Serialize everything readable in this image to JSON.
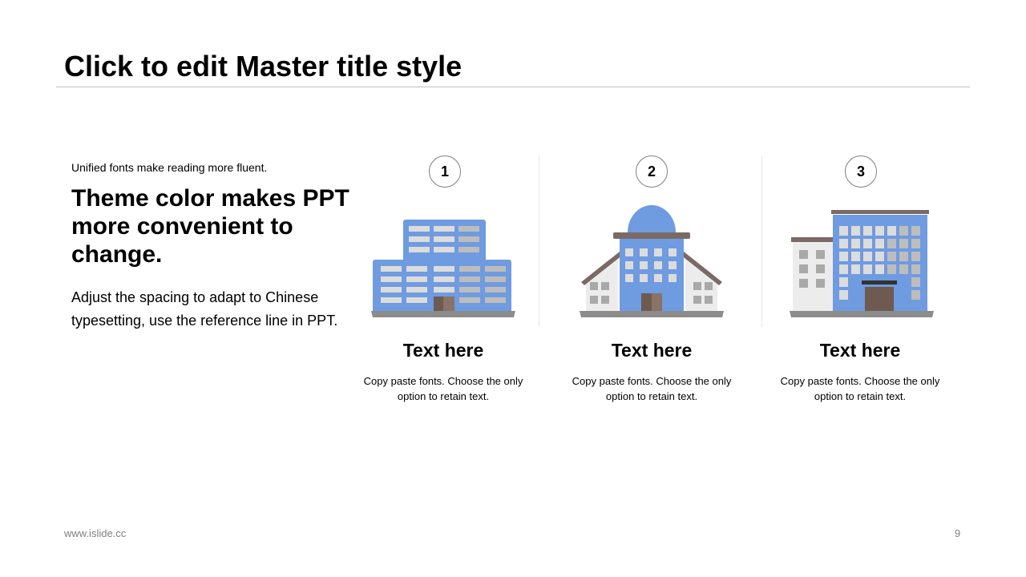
{
  "slide": {
    "title": "Click to edit Master title style"
  },
  "left": {
    "small_text": "Unified fonts make reading more fluent.",
    "headline": "Theme color makes PPT more convenient to change.",
    "body": "Adjust the spacing to adapt to Chinese typesetting, use the reference line in PPT."
  },
  "columns": [
    {
      "number": "1",
      "title": "Text here",
      "description": "Copy paste fonts. Choose the only option to retain text.",
      "icon": "office-building-icon"
    },
    {
      "number": "2",
      "title": "Text here",
      "description": "Copy paste fonts. Choose the only option to retain text.",
      "icon": "domed-building-icon"
    },
    {
      "number": "3",
      "title": "Text here",
      "description": "Copy paste fonts. Choose the only option to retain text.",
      "icon": "tower-building-icon"
    }
  ],
  "footer": {
    "url": "www.islide.cc",
    "page_number": "9"
  },
  "colors": {
    "accent_blue": "#6f9be0",
    "window_light": "#dcdcdc",
    "window_mid": "#bdbdbd",
    "roof_brown": "#7a6a66",
    "door_brown": "#6e5a50",
    "ground_gray": "#8c8c8c",
    "wall_light": "#ececec"
  }
}
